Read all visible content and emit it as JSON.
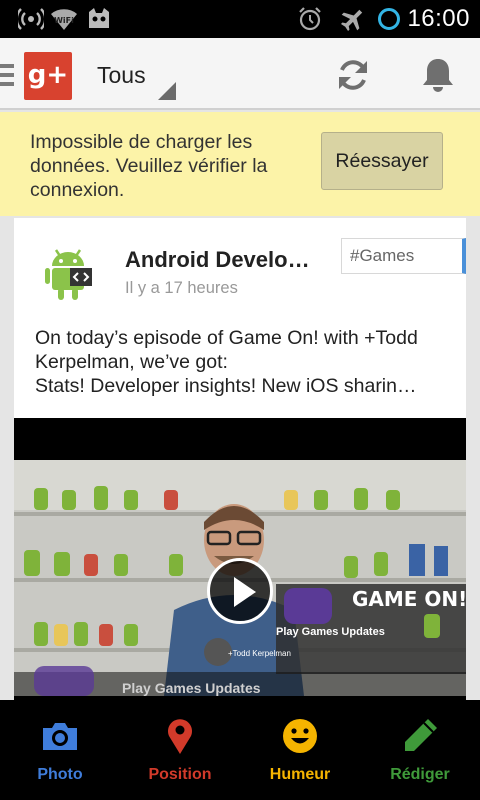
{
  "status_bar": {
    "time": "16:00",
    "icons": [
      "wifi-tethering-icon",
      "wifi-icon",
      "cyanogen-mascot-icon",
      "alarm-icon",
      "airplane-icon",
      "circle-icon"
    ]
  },
  "action_bar": {
    "app_logo": "g+",
    "title": "Tous",
    "icons": [
      "menu-icon",
      "refresh-icon",
      "notification-bell-icon"
    ]
  },
  "banner": {
    "message": "Impossible de charger les données. Veuillez vérifier la connexion.",
    "retry_label": "Réessayer",
    "color": "#fcf3a8"
  },
  "post": {
    "author": "Android Develo…",
    "time_ago": "Il y a 17 heures",
    "hashtag": "#Games",
    "lines": [
      "On today’s episode of Game On! with +Todd",
      "Kerpelman, we’ve got:",
      "Stats! Developer insights! New iOS sharin…"
    ],
    "video": {
      "overlay_title": "Play Games Updates",
      "inner_title": "Play Games Updates",
      "presenter": "+Todd Kerpelman",
      "logo_text": "GAME ON!"
    }
  },
  "bottom_bar": {
    "items": [
      {
        "label": "Photo",
        "icon": "camera-icon",
        "color": "#3f7ddb"
      },
      {
        "label": "Position",
        "icon": "location-pin-icon",
        "color": "#d23a2a"
      },
      {
        "label": "Humeur",
        "icon": "smiley-icon",
        "color": "#f5b400"
      },
      {
        "label": "Rédiger",
        "icon": "pencil-icon",
        "color": "#3f9a3a"
      }
    ]
  }
}
